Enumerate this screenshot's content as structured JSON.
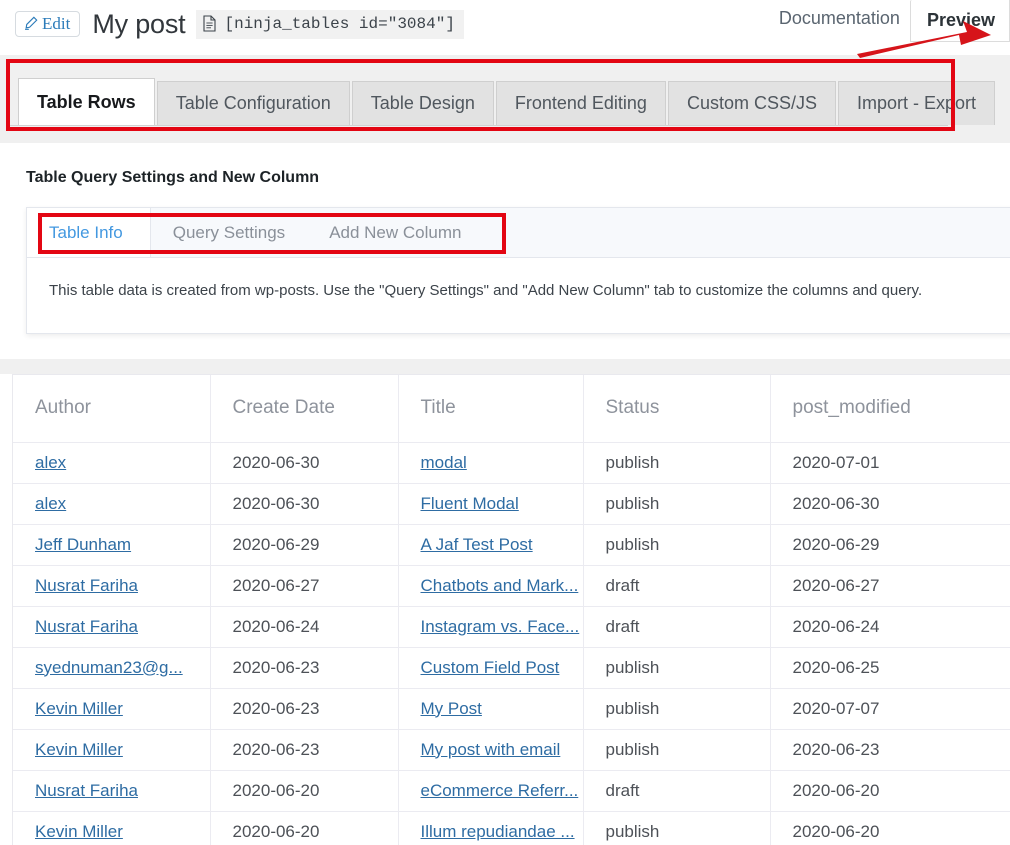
{
  "header": {
    "edit_label": "Edit",
    "edit_icon": "pencil-icon",
    "title": "My post",
    "shortcode": "[ninja_tables id=\"3084\"]",
    "shortcode_icon": "document-copy-icon",
    "documentation_label": "Documentation",
    "preview_label": "Preview"
  },
  "main_tabs": {
    "items": [
      {
        "label": "Table Rows",
        "active": true
      },
      {
        "label": "Table Configuration",
        "active": false
      },
      {
        "label": "Table Design",
        "active": false
      },
      {
        "label": "Frontend Editing",
        "active": false
      },
      {
        "label": "Custom CSS/JS",
        "active": false
      },
      {
        "label": "Import - Export",
        "active": false
      }
    ],
    "highlight_color": "#e30613"
  },
  "panel": {
    "title": "Table Query Settings and New Column",
    "card_tabs": [
      {
        "label": "Table Info",
        "active": true
      },
      {
        "label": "Query Settings",
        "active": false
      },
      {
        "label": "Add New Column",
        "active": false
      }
    ],
    "description": "This table data is created from wp-posts. Use the \"Query Settings\" and \"Add New Column\" tab to customize the columns and query.",
    "active_tab_color": "#4398e0",
    "highlight_color": "#e30613"
  },
  "table": {
    "columns": [
      "Author",
      "Create Date",
      "Title",
      "Status",
      "post_modified"
    ],
    "rows": [
      {
        "author": "alex",
        "create_date": "2020-06-30",
        "title": "modal",
        "status": "publish",
        "post_modified": "2020-07-01"
      },
      {
        "author": "alex",
        "create_date": "2020-06-30",
        "title": "Fluent Modal",
        "status": "publish",
        "post_modified": "2020-06-30"
      },
      {
        "author": "Jeff Dunham",
        "create_date": "2020-06-29",
        "title": "A Jaf Test Post",
        "status": "publish",
        "post_modified": "2020-06-29"
      },
      {
        "author": "Nusrat Fariha",
        "create_date": "2020-06-27",
        "title": "Chatbots and Mark...",
        "status": "draft",
        "post_modified": "2020-06-27"
      },
      {
        "author": "Nusrat Fariha",
        "create_date": "2020-06-24",
        "title": "Instagram vs. Face...",
        "status": "draft",
        "post_modified": "2020-06-24"
      },
      {
        "author": "syednuman23@g...",
        "create_date": "2020-06-23",
        "title": "Custom Field Post",
        "status": "publish",
        "post_modified": "2020-06-25"
      },
      {
        "author": "Kevin Miller",
        "create_date": "2020-06-23",
        "title": "My Post",
        "status": "publish",
        "post_modified": "2020-07-07"
      },
      {
        "author": "Kevin Miller",
        "create_date": "2020-06-23",
        "title": "My post with email",
        "status": "publish",
        "post_modified": "2020-06-23"
      },
      {
        "author": "Nusrat Fariha",
        "create_date": "2020-06-20",
        "title": "eCommerce Referr...",
        "status": "draft",
        "post_modified": "2020-06-20"
      },
      {
        "author": "Kevin Miller",
        "create_date": "2020-06-20",
        "title": "Illum repudiandae ...",
        "status": "publish",
        "post_modified": "2020-06-20"
      }
    ]
  },
  "annotations": {
    "arrow_color": "#d6141a",
    "arrow_target": "preview-tab"
  }
}
